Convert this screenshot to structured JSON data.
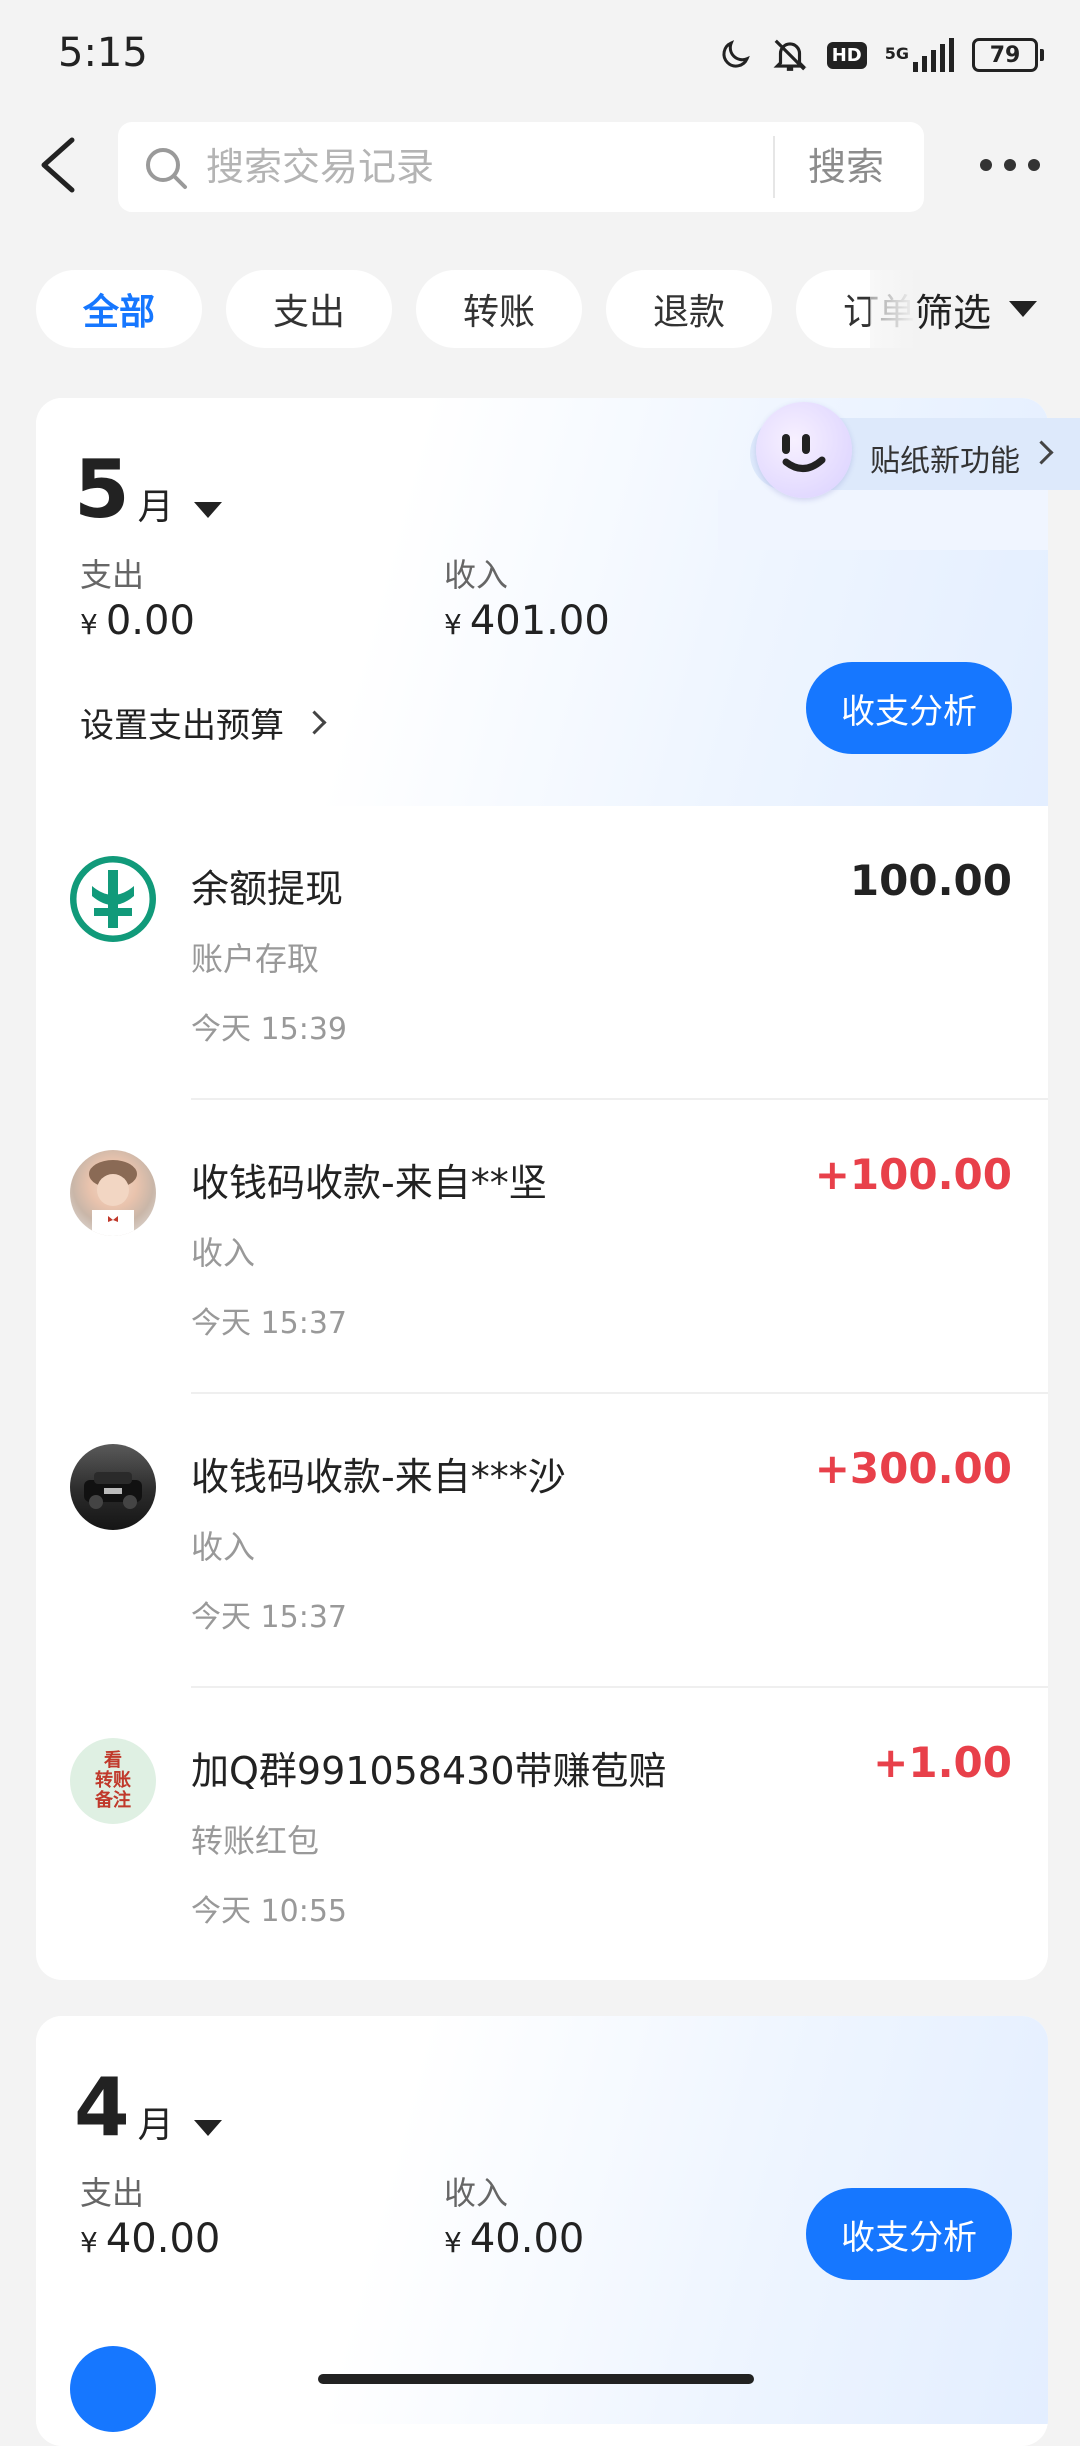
{
  "status_bar": {
    "time": "5:15",
    "network": "5G",
    "hd": "HD",
    "battery": "79"
  },
  "header": {
    "search_placeholder": "搜索交易记录",
    "search_button": "搜索"
  },
  "filters": {
    "chips": [
      "全部",
      "支出",
      "转账",
      "退款",
      "订单"
    ],
    "filter_button": "筛选"
  },
  "sticker": {
    "label": "贴纸新功能"
  },
  "months": [
    {
      "month": "5",
      "unit": "月",
      "expense_label": "支出",
      "expense_value": "0.00",
      "income_label": "收入",
      "income_value": "401.00",
      "currency": "¥",
      "budget_link": "设置支出预算",
      "analysis_button": "收支分析",
      "transactions": [
        {
          "title": "余额提现",
          "category": "账户存取",
          "time": "今天 15:39",
          "amount": "100.00",
          "type": "neutral"
        },
        {
          "title": "收钱码收款-来自**坚",
          "category": "收入",
          "time": "今天 15:37",
          "amount": "+100.00",
          "type": "income"
        },
        {
          "title": "收钱码收款-来自***沙",
          "category": "收入",
          "time": "今天 15:37",
          "amount": "+300.00",
          "type": "income"
        },
        {
          "title": "加Q群991058430带赚苞赔",
          "category": "转账红包",
          "time": "今天 10:55",
          "amount": "+1.00",
          "type": "income",
          "avatar_text": "看\n转账\n备注"
        }
      ]
    },
    {
      "month": "4",
      "unit": "月",
      "expense_label": "支出",
      "expense_value": "40.00",
      "income_label": "收入",
      "income_value": "40.00",
      "currency": "¥",
      "analysis_button": "收支分析"
    }
  ],
  "colors": {
    "accent": "#1677ff",
    "income": "#e8404a"
  }
}
